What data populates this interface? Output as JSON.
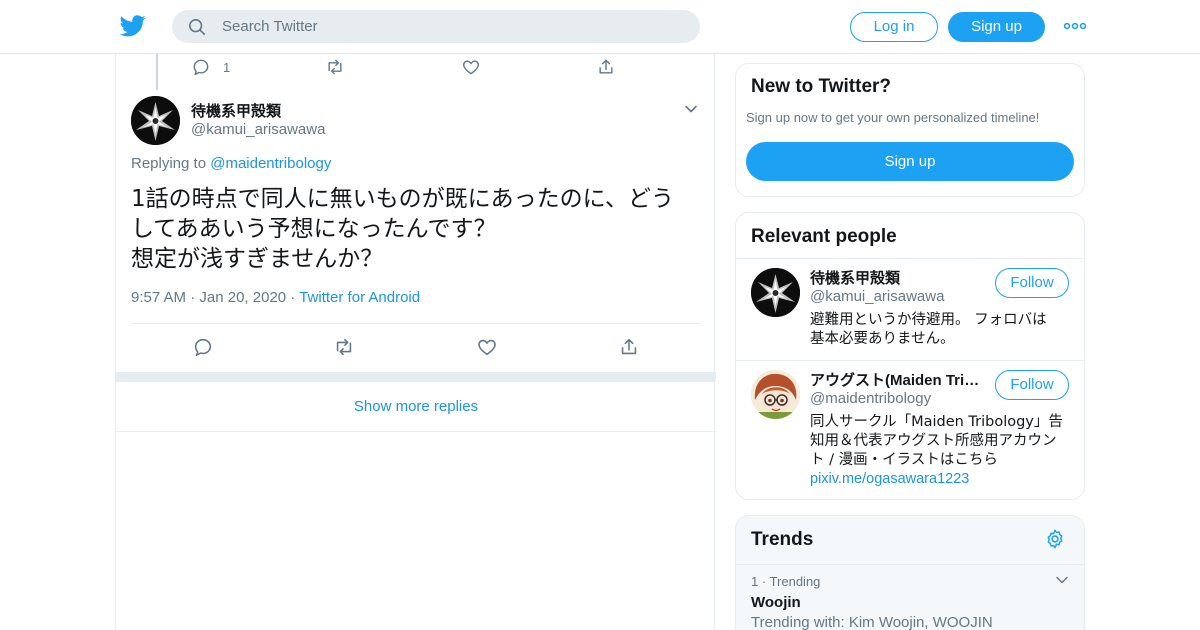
{
  "header": {
    "search_placeholder": "Search Twitter",
    "login_label": "Log in",
    "signup_label": "Sign up"
  },
  "previous_tweet": {
    "reply_count": "1"
  },
  "tweet": {
    "display_name": "待機系甲殻類",
    "handle": "@kamui_arisawawa",
    "replying_prefix": "Replying to",
    "replying_to": "@maidentribology",
    "text_lines": [
      "1話の時点で同人に無いものが既にあったのに、どう",
      "してああいう予想になったんです？",
      "想定が浅すぎませんか？"
    ],
    "time": "9:57 AM",
    "date": "Jan 20, 2020",
    "source": "Twitter for Android"
  },
  "show_more_label": "Show more replies",
  "new_to_twitter": {
    "title": "New to Twitter?",
    "subtitle": "Sign up now to get your own personalized timeline!",
    "button": "Sign up"
  },
  "relevant_people": {
    "title": "Relevant people",
    "people": [
      {
        "name": "待機系甲殻類",
        "handle": "@kamui_arisawawa",
        "bio_lines": [
          "避難用というか待避用。 フォロバは",
          "基本必要ありません。"
        ],
        "link": "",
        "follow_label": "Follow"
      },
      {
        "name": "アウグスト(Maiden Tribology)",
        "handle": "@maidentribology",
        "bio_lines": [
          "同人サークル「Maiden Tribology」告",
          "知用＆代表アウグスト所感用アカウン",
          "ト / 漫画・イラストはこちら"
        ],
        "link": "pixiv.me/ogasawara1223",
        "follow_label": "Follow"
      }
    ]
  },
  "trends": {
    "title": "Trends",
    "items": [
      {
        "rank": "1",
        "label": "Trending",
        "name": "Woojin",
        "with": "Trending with: Kim Woojin, WOOJIN"
      }
    ]
  },
  "colors": {
    "brand_blue": "#1da1f2",
    "link_blue": "#1b95e0",
    "secondary_text": "#657786",
    "border": "#e6ecf0"
  }
}
